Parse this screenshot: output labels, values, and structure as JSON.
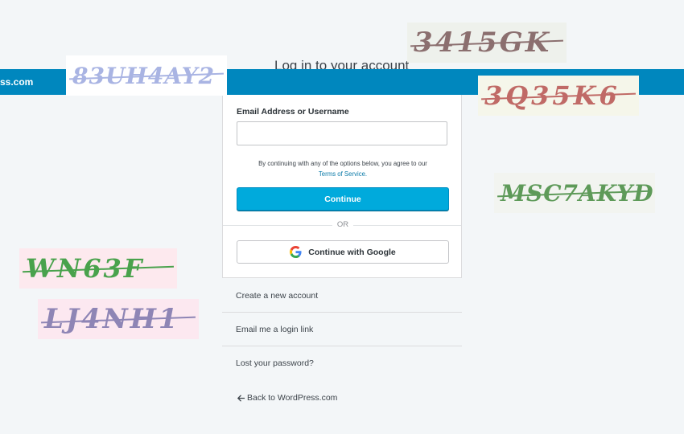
{
  "page": {
    "heading": "Log in to your account",
    "brand": "ss.com"
  },
  "login": {
    "email_label": "Email Address or Username",
    "email_value": "",
    "email_placeholder": "",
    "tos_text": "By continuing with any of the options below, you agree to our",
    "tos_link": "Terms of Service.",
    "continue_label": "Continue",
    "or_label": "OR",
    "google_label": "Continue with Google"
  },
  "links": [
    {
      "label": "Create a new account"
    },
    {
      "label": "Email me a login link"
    },
    {
      "label": "Lost your password?"
    }
  ],
  "back_link": "Back to WordPress.com",
  "captchas": [
    {
      "text": "3415GK",
      "bg": "#eef1ec",
      "color": "#8b6f6f"
    },
    {
      "text": "83UH4AY2",
      "bg": "#ffffff",
      "color": "#a9b4e3"
    },
    {
      "text": "3Q35K6",
      "bg": "#f5f6ea",
      "color": "#c06a66"
    },
    {
      "text": "MSC7AKYD",
      "bg": "#f2f4f0",
      "color": "#5e9a59"
    },
    {
      "text": "WN63F",
      "bg": "#fde9ee",
      "color": "#49a24c"
    },
    {
      "text": "LJ4NH1",
      "bg": "#fce8f0",
      "color": "#8e85b5"
    }
  ],
  "colors": {
    "topbar": "#0087be",
    "primary_button": "#00aadc",
    "page_bg": "#f3f6f8"
  }
}
